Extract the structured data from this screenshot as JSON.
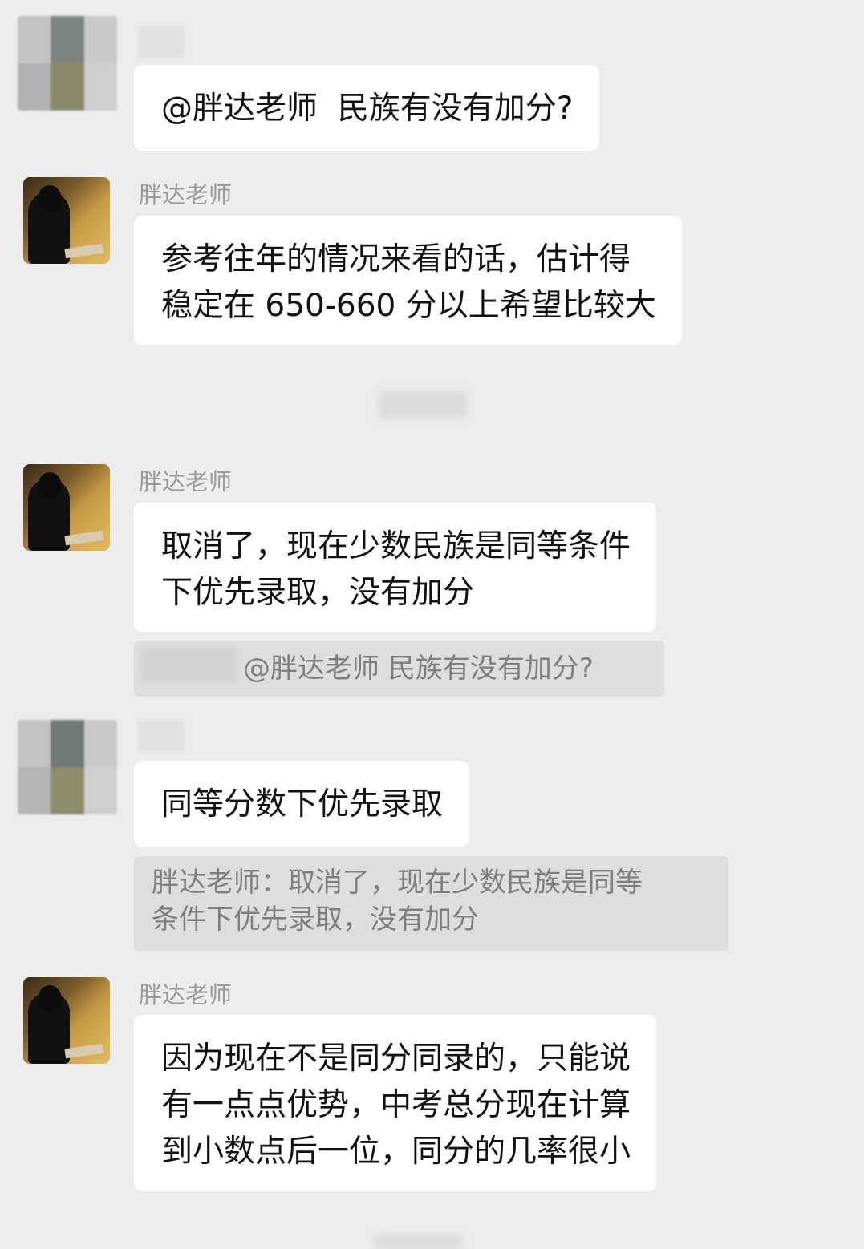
{
  "messages": [
    {
      "sender": "",
      "text": "@胖达老师  民族有没有加分?"
    },
    {
      "sender": "胖达老师",
      "text": "参考往年的情况来看的话，估计得\n稳定在 650-660 分以上希望比较大"
    },
    {
      "sender": "胖达老师",
      "text": "取消了，现在少数民族是同等条件\n下优先录取，没有加分",
      "quote": "@胖达老师 民族有没有加分?"
    },
    {
      "sender": "",
      "text": "同等分数下优先录取",
      "quote": "胖达老师：取消了，现在少数民族是同等\n条件下优先录取，没有加分"
    },
    {
      "sender": "胖达老师",
      "text": "因为现在不是同分同录的，只能说\n有一点点优势，中考总分现在计算\n到小数点后一位，同分的几率很小"
    }
  ],
  "colors": {
    "background": "#ededed",
    "bubble": "#ffffff",
    "quote_bg": "#dedede",
    "name_text": "#9a9a9a"
  }
}
